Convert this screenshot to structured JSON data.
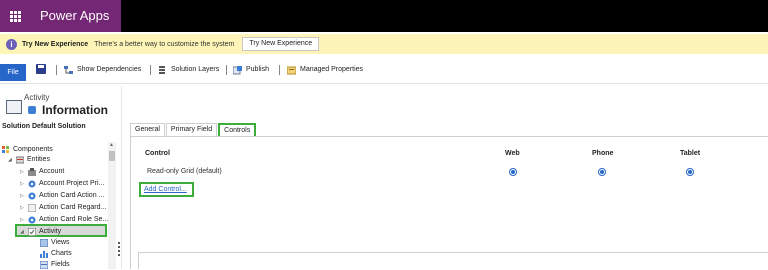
{
  "app": {
    "title": "Power Apps"
  },
  "infobar": {
    "title": "Try New Experience",
    "message": "There's a better way to customize the system",
    "button": "Try New Experience"
  },
  "toolbar": {
    "file": "File",
    "show_dependencies": "Show Dependencies",
    "solution_layers": "Solution Layers",
    "publish": "Publish",
    "managed_properties": "Managed Properties"
  },
  "left": {
    "breadcrumb": "Activity",
    "heading": "Information",
    "solution": "Solution Default Solution",
    "tree": [
      {
        "label": "Components"
      },
      {
        "label": "Entities"
      },
      {
        "label": "Account"
      },
      {
        "label": "Account Project Pri..."
      },
      {
        "label": "Action Card Action ..."
      },
      {
        "label": "Action Card Regard..."
      },
      {
        "label": "Action Card Role Se..."
      },
      {
        "label": "Activity"
      },
      {
        "label": "Views"
      },
      {
        "label": "Charts"
      },
      {
        "label": "Fields"
      }
    ]
  },
  "tabs": [
    {
      "label": "General"
    },
    {
      "label": "Primary Field"
    },
    {
      "label": "Controls"
    }
  ],
  "grid": {
    "headers": {
      "control": "Control",
      "web": "Web",
      "phone": "Phone",
      "tablet": "Tablet"
    },
    "rows": [
      {
        "control": "Read-only Grid (default)"
      }
    ],
    "add_control": "Add Control..."
  },
  "colors": {
    "brand": "#742774",
    "accent": "#2766c9",
    "highlight": "#3aad3a",
    "infobar": "#fdf4b7"
  }
}
